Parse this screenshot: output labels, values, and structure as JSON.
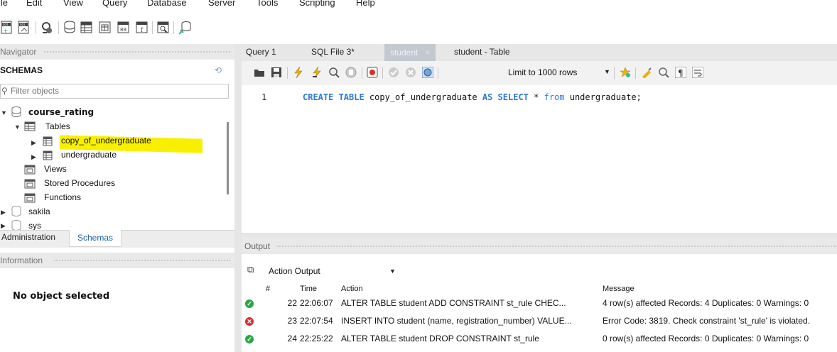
{
  "menu": [
    "File",
    "Edit",
    "View",
    "Query",
    "Database",
    "Server",
    "Tools",
    "Scripting",
    "Help"
  ],
  "menu_display": [
    "ile",
    "Edit",
    "View",
    "Query",
    "Database",
    "Server",
    "Tools",
    "Scripting",
    "Help"
  ],
  "navigator": {
    "header": "Navigator",
    "schemas_title": "SCHEMAS",
    "filter_placeholder": "Filter objects",
    "tree": {
      "schema": "course_rating",
      "tables_label": "Tables",
      "table1": "copy_of_undergraduate",
      "table2": "undergraduate",
      "views": "Views",
      "procs": "Stored Procedures",
      "funcs": "Functions",
      "schema2": "sakila",
      "schema3": "sys"
    },
    "tabs": {
      "admin": "Administration",
      "schemas": "Schemas"
    }
  },
  "information": {
    "header": "Information",
    "empty": "No object selected"
  },
  "editor": {
    "tabs": [
      "Query 1",
      "SQL File 3*",
      "student",
      "student - Table"
    ],
    "limit_label": "Limit to 1000 rows",
    "line_number": "1",
    "sql": {
      "kw1": "CREATE TABLE",
      "name": " copy_of_undergraduate ",
      "kw2": "AS SELECT",
      "star": " * ",
      "kw3": "from",
      "rest": " undergraduate;"
    }
  },
  "output": {
    "header": "Output",
    "selector": "Action Output",
    "columns": [
      "#",
      "Time",
      "Action",
      "Message"
    ],
    "rows": [
      {
        "status": "ok",
        "num": "22",
        "time": "22:06:07",
        "action": "ALTER TABLE student ADD CONSTRAINT st_rule CHEC...",
        "message": "4 row(s) affected Records: 4  Duplicates: 0  Warnings: 0"
      },
      {
        "status": "error",
        "num": "23",
        "time": "22:07:54",
        "action": "INSERT INTO student (name, registration_number) VALUE...",
        "message": "Error Code: 3819. Check constraint 'st_rule' is violated."
      },
      {
        "status": "ok",
        "num": "24",
        "time": "22:25:22",
        "action": "ALTER TABLE student DROP CONSTRAINT st_rule",
        "message": "0 row(s) affected Records: 0  Duplicates: 0  Warnings: 0"
      }
    ]
  },
  "colors": {
    "highlight": "#f8f000",
    "keyword": "#2d7ad6",
    "ok": "#28a745",
    "error": "#d62d2d"
  }
}
